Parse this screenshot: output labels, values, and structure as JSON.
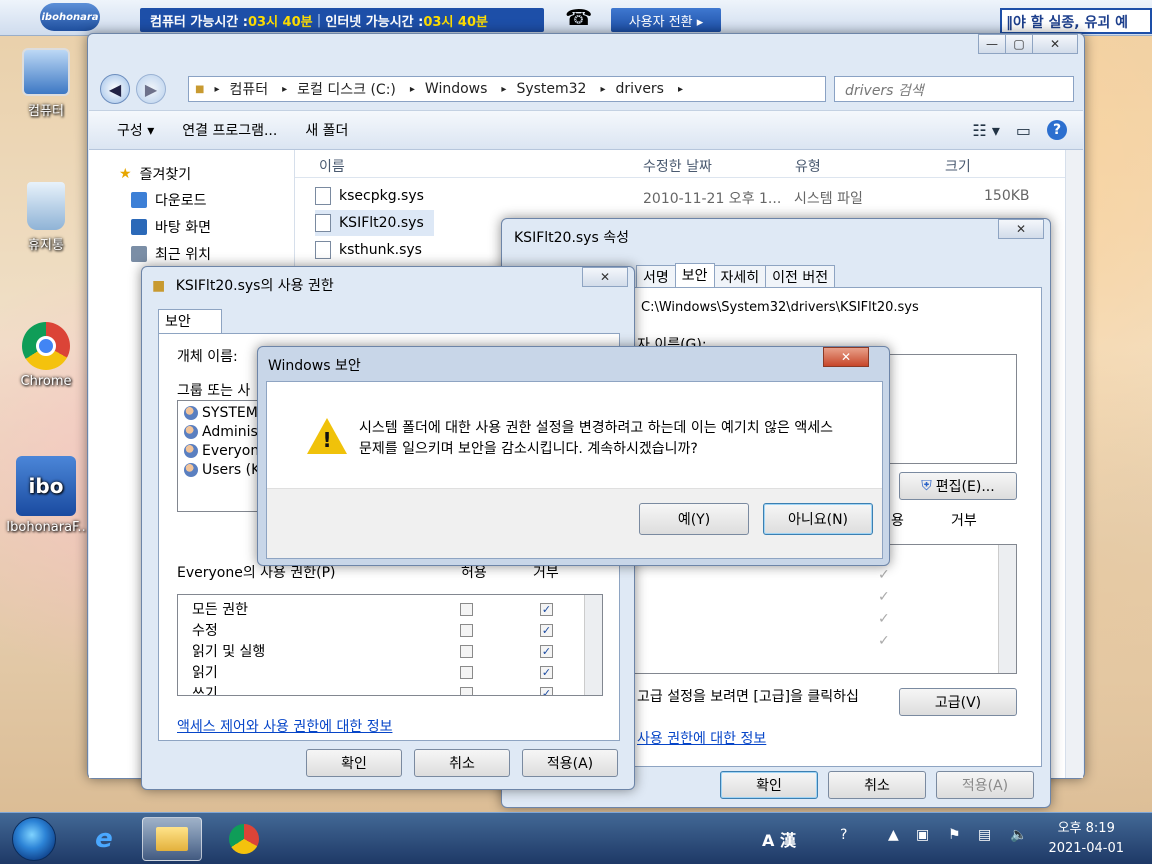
{
  "topbar": {
    "logo": "ibohonara",
    "pc_time_label": "컴퓨터 가능시간 : ",
    "pc_time_value": "03시 40분",
    "net_time_label": " 인터넷 가능시간 : ",
    "net_time_value": "03시 40분",
    "switch_user": "사용자 전환 ▸",
    "ticker": "‖야 할 실종, 유괴 예"
  },
  "desktop": {
    "computer": "컴퓨터",
    "recycle": "휴지통",
    "chrome": "Chrome",
    "ibohonara": "IbohonaraF..",
    "ibo_logo": "ibo"
  },
  "explorer": {
    "address": [
      "컴퓨터",
      "로컬 디스크 (C:)",
      "Windows",
      "System32",
      "drivers"
    ],
    "search_placeholder": "drivers 검색",
    "toolbar": {
      "organize": "구성 ▾",
      "open_with": "연결 프로그램...",
      "new_folder": "새 폴더"
    },
    "nav": {
      "favorites": "즐겨찾기",
      "downloads": "다운로드",
      "desktop": "바탕 화면",
      "recent": "최근 위치"
    },
    "columns": {
      "name": "이름",
      "modified": "수정한 날짜",
      "type": "유형",
      "size": "크기"
    },
    "files": [
      {
        "name": "ksecpkg.sys",
        "date": "2010-11-21 오후 1...",
        "type": "시스템 파일",
        "size": "150KB"
      },
      {
        "name": "KSIFlt20.sys"
      },
      {
        "name": "ksthunk.sys"
      }
    ]
  },
  "props": {
    "title": "KSIFlt20.sys 속성",
    "tabs": [
      "서명",
      "보안",
      "자세히",
      "이전 버전"
    ],
    "path": "C:\\Windows\\System32\\drivers\\KSIFlt20.sys",
    "group_label": "자 이름(G):",
    "edit_button": "편집(E)...",
    "perm_allow_header": "용",
    "perm_deny_header": "거부",
    "advanced_text": "고급 설정을 보려면 [고급]을 클릭하십",
    "advanced_button": "고급(V)",
    "link": "사용 권한에 대한 정보",
    "ok": "확인",
    "cancel": "취소",
    "apply": "적용(A)"
  },
  "perms": {
    "title": "KSIFlt20.sys의 사용 권한",
    "tab": "보안",
    "object_label": "개체 이름:",
    "group_label": "그룹 또는 사",
    "users": [
      "SYSTEM",
      "Administ",
      "Everyone",
      "Users (K"
    ],
    "perm_for": "Everyone의 사용 권한(P)",
    "allow": "허용",
    "deny": "거부",
    "rows": [
      "모든 권한",
      "수정",
      "읽기 및 실행",
      "읽기",
      "쓰기"
    ],
    "link": "액세스 제어와 사용 권한에 대한 정보",
    "ok": "확인",
    "cancel": "취소",
    "apply": "적용(A)"
  },
  "security": {
    "title": "Windows 보안",
    "message": "시스템 폴더에 대한 사용 권한 설정을 변경하려고 하는데 이는 예기치 않은 액세스 문제를 일으키며 보안을 감소시킵니다. 계속하시겠습니까?",
    "yes": "예(Y)",
    "no": "아니요(N)"
  },
  "taskbar": {
    "ime": "A 漢",
    "time": "오후 8:19",
    "date": "2021-04-01"
  },
  "colors": {
    "accent": "#1d4fa8",
    "time_value": "#ffde00",
    "link": "#0645c8"
  }
}
